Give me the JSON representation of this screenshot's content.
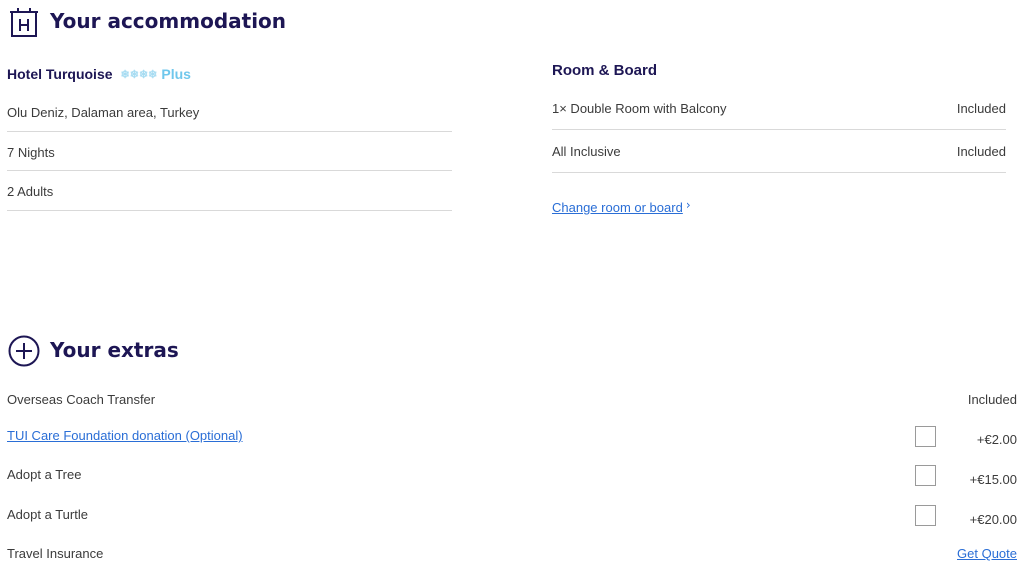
{
  "accommodation": {
    "title": "Your accommodation",
    "hotel_name": "Hotel Turquoise",
    "rating_stars": "❄❄❄❄",
    "rating_suffix": "Plus",
    "details": [
      "Olu Deniz, Dalaman area, Turkey",
      "7 Nights",
      "2  Adults"
    ],
    "room_board": {
      "title": "Room & Board",
      "items": [
        {
          "label": "1× Double Room with Balcony",
          "value": "Included"
        },
        {
          "label": "All Inclusive",
          "value": "Included"
        }
      ],
      "change_link": "Change room or board",
      "chevron": "›"
    }
  },
  "extras": {
    "title": "Your extras",
    "items": [
      {
        "label": "Overseas Coach Transfer",
        "value": "Included"
      },
      {
        "label": "TUI Care Foundation donation (Optional)",
        "price": "+€2.00"
      },
      {
        "label": "Adopt a Tree",
        "price": "+€15.00"
      },
      {
        "label": "Adopt a Turtle",
        "price": "+€20.00"
      },
      {
        "label": "Travel Insurance",
        "link": "Get Quote"
      }
    ]
  },
  "colors": {
    "heading": "#1d1654",
    "link": "#2a6ed6",
    "rating": "#6fc7ec"
  }
}
